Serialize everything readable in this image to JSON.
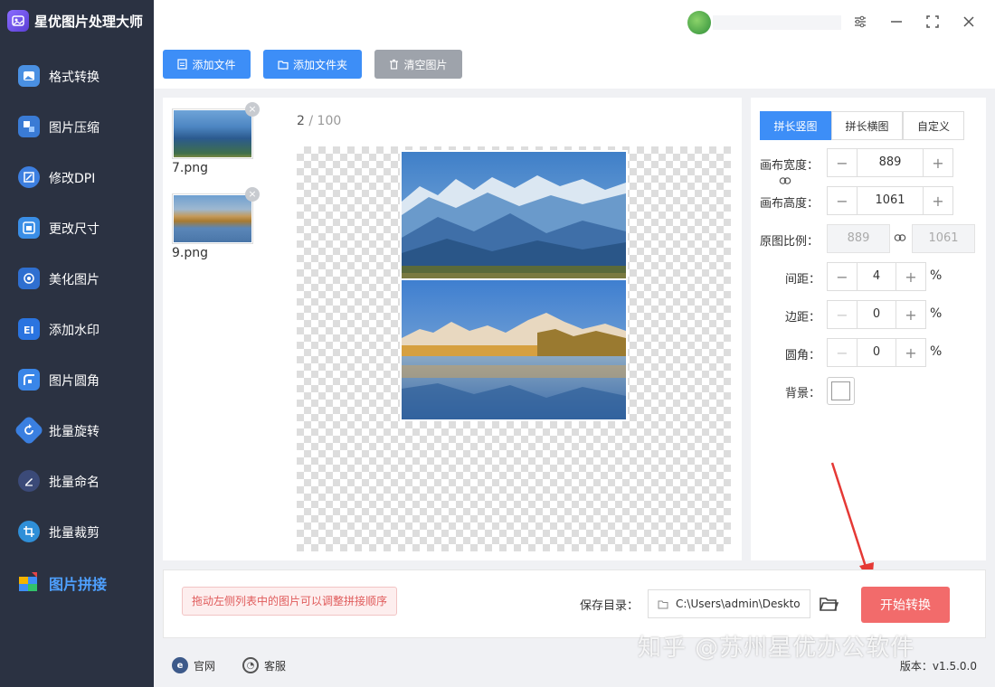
{
  "app": {
    "title": "星优图片处理大师"
  },
  "sidebar": {
    "items": [
      {
        "label": "格式转换",
        "icon": "image-convert-icon"
      },
      {
        "label": "图片压缩",
        "icon": "image-compress-icon"
      },
      {
        "label": "修改DPI",
        "icon": "dpi-icon"
      },
      {
        "label": "更改尺寸",
        "icon": "resize-icon"
      },
      {
        "label": "美化图片",
        "icon": "beautify-icon"
      },
      {
        "label": "添加水印",
        "icon": "watermark-icon"
      },
      {
        "label": "图片圆角",
        "icon": "rounded-corner-icon"
      },
      {
        "label": "批量旋转",
        "icon": "rotate-icon"
      },
      {
        "label": "批量命名",
        "icon": "rename-icon"
      },
      {
        "label": "批量裁剪",
        "icon": "crop-icon"
      },
      {
        "label": "图片拼接",
        "icon": "stitch-icon",
        "active": true
      }
    ]
  },
  "toolbar": {
    "add_file": "添加文件",
    "add_folder": "添加文件夹",
    "clear": "清空图片"
  },
  "files": [
    {
      "name": "7.png"
    },
    {
      "name": "9.png"
    }
  ],
  "preview": {
    "current": "2",
    "separator": " / ",
    "total": "100"
  },
  "settings": {
    "tabs": [
      "拼长竖图",
      "拼长横图",
      "自定义"
    ],
    "active_tab": "拼长竖图",
    "canvas_width_label": "画布宽度：",
    "canvas_width": "889",
    "canvas_height_label": "画布高度：",
    "canvas_height": "1061",
    "ratio_label": "原图比例：",
    "ratio_width": "889",
    "ratio_height": "1061",
    "spacing_label": "间距：",
    "spacing": "4",
    "margin_label": "边距：",
    "margin": "0",
    "radius_label": "圆角：",
    "radius": "0",
    "bg_label": "背景：",
    "percent": "%",
    "minus": "−",
    "plus": "+"
  },
  "bottom": {
    "hint": "拖动左侧列表中的图片可以调整拼接顺序",
    "save_label": "保存目录：",
    "save_path": "C:\\Users\\admin\\Deskto",
    "start": "开始转换"
  },
  "footer": {
    "website": "官网",
    "support": "客服",
    "version": "版本：v1.5.0.0"
  },
  "watermark": "知乎 @苏州星优办公软件",
  "colors": {
    "accent": "#3d8ef7",
    "start_button": "#f26b6b",
    "sidebar_bg": "#2b3242"
  }
}
